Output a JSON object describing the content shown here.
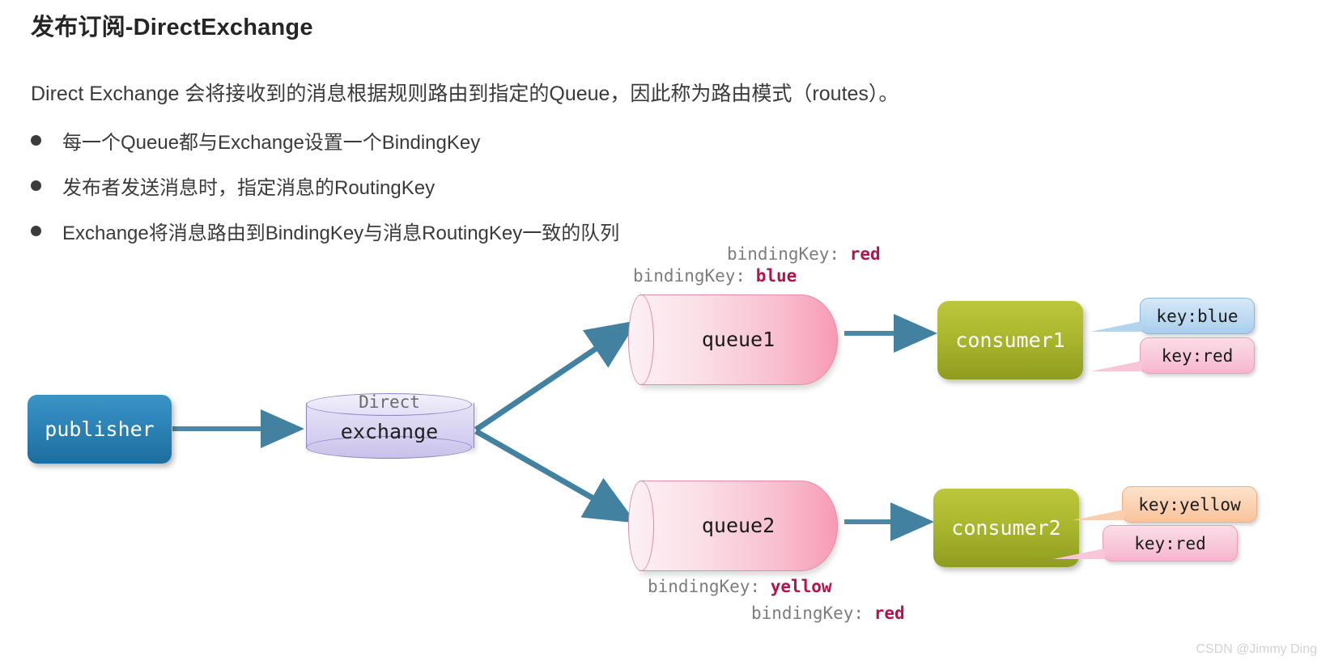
{
  "page_title": "发布订阅-DirectExchange",
  "intro_paragraph": "Direct Exchange 会将接收到的消息根据规则路由到指定的Queue，因此称为路由模式（routes）。",
  "bullets": [
    "每一个Queue都与Exchange设置一个BindingKey",
    "发布者发送消息时，指定消息的RoutingKey",
    "Exchange将消息路由到BindingKey与消息RoutingKey一致的队列"
  ],
  "diagram": {
    "publisher": {
      "label": "publisher",
      "color": "#2d85b8"
    },
    "exchange": {
      "type_label": "Direct",
      "label": "exchange",
      "color": "#ddd8f3"
    },
    "queues": [
      {
        "label": "queue1",
        "color": "#f9bfd0"
      },
      {
        "label": "queue2",
        "color": "#f9bfd0"
      }
    ],
    "consumers": [
      {
        "label": "consumer1",
        "color": "#aebb2f"
      },
      {
        "label": "consumer2",
        "color": "#aebb2f"
      }
    ],
    "binding_labels": [
      {
        "prefix": "bindingKey: ",
        "value": "red",
        "value_color": "#b4144b"
      },
      {
        "prefix": "bindingKey: ",
        "value": "blue",
        "value_color": "#b4144b"
      },
      {
        "prefix": "bindingKey: ",
        "value": "yellow",
        "value_color": "#b4144b"
      },
      {
        "prefix": "bindingKey: ",
        "value": "red",
        "value_color": "#b4144b"
      }
    ],
    "bubbles": [
      {
        "label": "key:blue",
        "color": "#bcd9f1"
      },
      {
        "label": "key:red",
        "color": "#f8c6d8"
      },
      {
        "label": "key:yellow",
        "color": "#fbcfae"
      },
      {
        "label": "key:red",
        "color": "#f8c6d8"
      }
    ]
  },
  "watermark": "CSDN @Jimmy Ding"
}
